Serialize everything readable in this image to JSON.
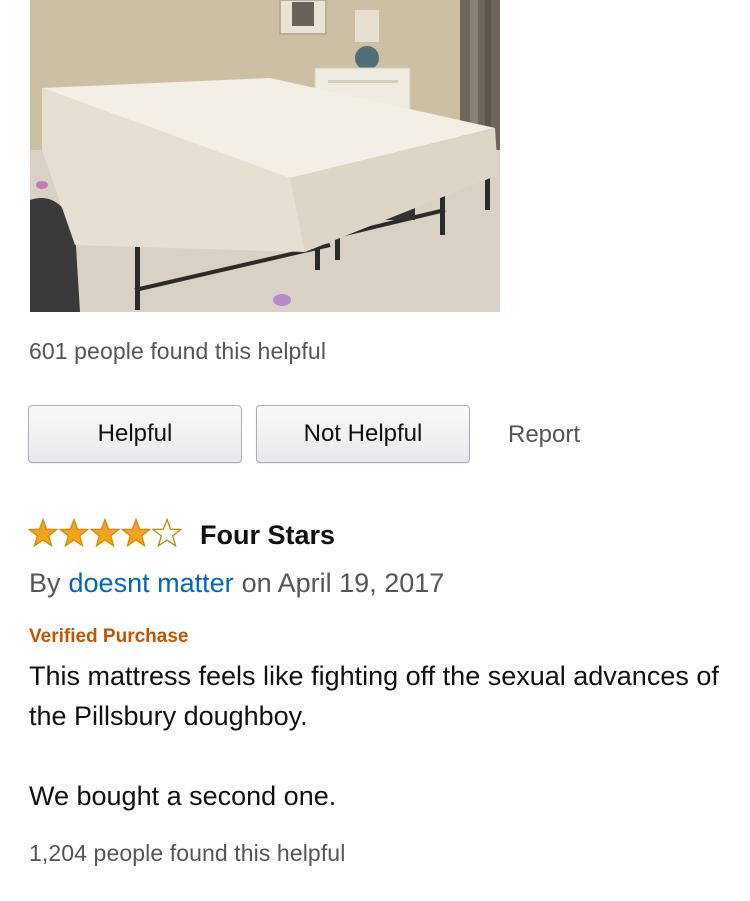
{
  "photo": {
    "icon": "mattress-photo"
  },
  "previous_review": {
    "helpful_count": "601 people found this helpful"
  },
  "actions": {
    "helpful_label": "Helpful",
    "not_helpful_label": "Not Helpful",
    "report_label": "Report"
  },
  "review": {
    "rating": 4,
    "rating_max": 5,
    "star_color": "#f4a41c",
    "title": "Four Stars",
    "by_prefix": "By",
    "author": "doesnt matter",
    "date": "on April 19, 2017",
    "verified": "Verified Purchase",
    "body_line1": "This mattress feels like fighting off the sexual advances of the Pillsbury doughboy.",
    "body_line2": "We bought a second one.",
    "helpful_count": "1,204 people found this helpful"
  },
  "colors": {
    "link": "#0066c0",
    "verified": "#c45500",
    "muted_text": "#555555"
  }
}
